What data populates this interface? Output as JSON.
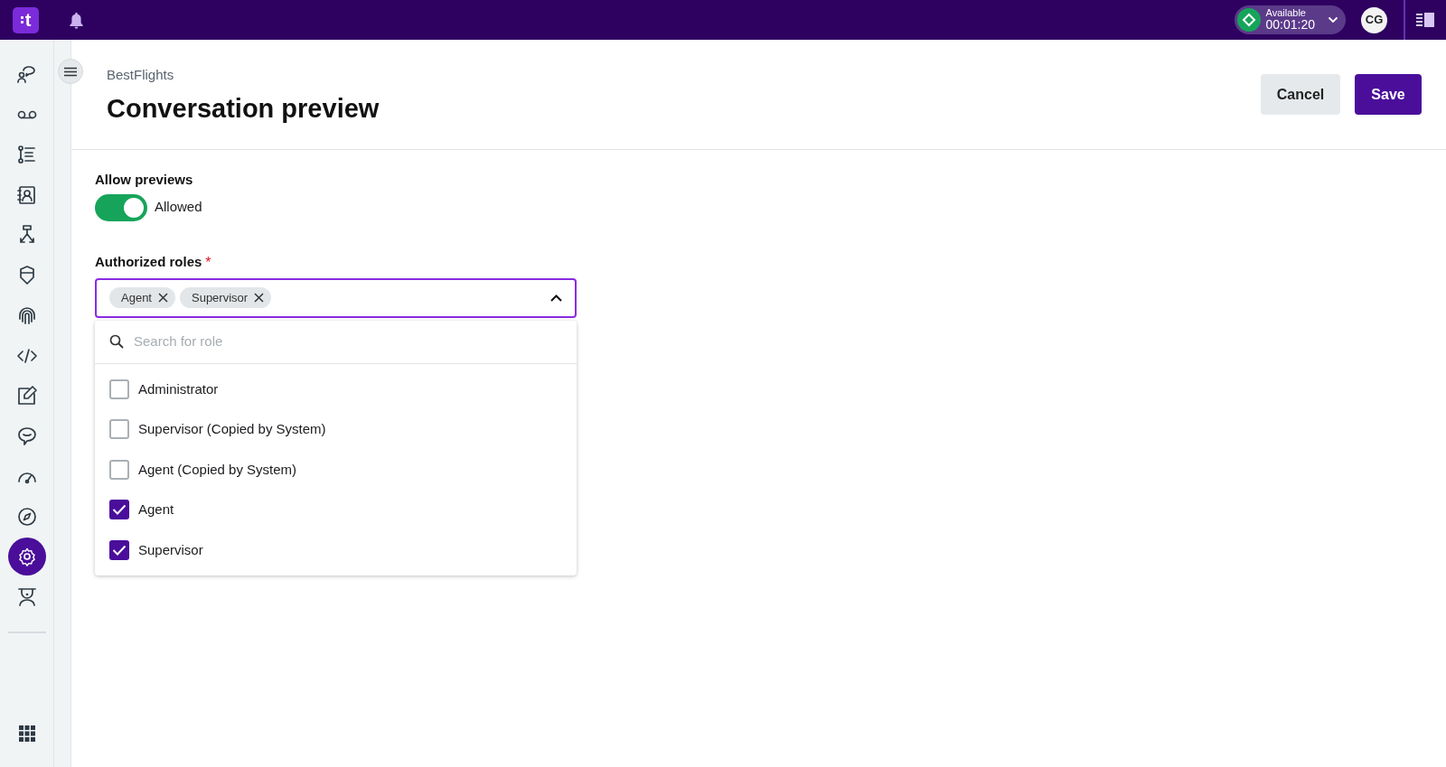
{
  "topbar": {
    "logo": {
      "text": "t"
    },
    "status": {
      "label": "Available",
      "timer": "00:01:20"
    },
    "avatar": "CG"
  },
  "sidebar": {
    "items": [
      {
        "selected": false
      },
      {
        "selected": false
      },
      {
        "selected": false
      },
      {
        "selected": false
      },
      {
        "selected": false
      },
      {
        "selected": false
      },
      {
        "selected": false
      },
      {
        "selected": false
      },
      {
        "selected": false
      },
      {
        "selected": false
      },
      {
        "selected": false
      },
      {
        "selected": false
      },
      {
        "selected": true
      },
      {
        "selected": false
      }
    ]
  },
  "header": {
    "breadcrumb": "BestFlights",
    "title": "Conversation preview",
    "buttons": [
      {
        "label": "Cancel",
        "kind": "secondary"
      },
      {
        "label": "Save",
        "kind": "primary"
      }
    ]
  },
  "form": {
    "allow_previews": {
      "label": "Allow previews",
      "on": true,
      "state_text": "Allowed"
    },
    "roles": {
      "label": "Authorized roles",
      "required_mark": "*",
      "tags": [
        "Agent",
        "Supervisor"
      ],
      "expanded": true,
      "search": {
        "placeholder": "Search for role"
      },
      "options": [
        {
          "label": "Administrator",
          "checked": false
        },
        {
          "label": "Supervisor (Copied by System)",
          "checked": false
        },
        {
          "label": "Agent (Copied by System)",
          "checked": false
        },
        {
          "label": "Agent",
          "checked": true
        },
        {
          "label": "Supervisor",
          "checked": true
        }
      ]
    }
  }
}
